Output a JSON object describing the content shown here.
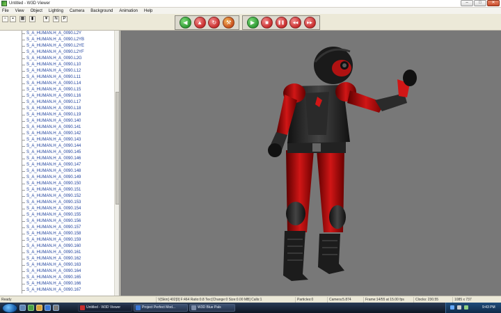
{
  "window": {
    "title": "Untitled - W3D Viewer",
    "buttons": [
      "–",
      "□",
      "✕"
    ]
  },
  "menu": [
    "File",
    "View",
    "Object",
    "Lighting",
    "Camera",
    "Background",
    "Animation",
    "Help"
  ],
  "toolbar": {
    "small_buttons": [
      "▫",
      "▪",
      "▦",
      "▮",
      "¥",
      "N",
      "P"
    ],
    "camera_buttons": [
      {
        "icon": "left-arrow-icon",
        "glyph": "◀",
        "color": "#2f9a34"
      },
      {
        "icon": "up-arrow-icon",
        "glyph": "▲",
        "color": "#c82d2d"
      },
      {
        "icon": "rotate-icon",
        "glyph": "↻",
        "color": "#c82d2d"
      },
      {
        "icon": "hammer-icon",
        "glyph": "⚒",
        "color": "#c82d2d"
      }
    ],
    "animation_buttons": [
      {
        "icon": "play-icon",
        "glyph": "▶",
        "color": "#2f9a34"
      },
      {
        "icon": "stop-icon",
        "glyph": "■",
        "color": "#c82d2d"
      },
      {
        "icon": "pause-icon",
        "glyph": "❚❚",
        "color": "#c82d2d"
      },
      {
        "icon": "rewind-icon",
        "glyph": "◀◀",
        "color": "#c82d2d"
      },
      {
        "icon": "fast-forward-icon",
        "glyph": "▶▶",
        "color": "#c82d2d"
      }
    ]
  },
  "tree": {
    "items": [
      "S_A_HUMAN.H_A_0090.L2Y",
      "S_A_HUMAN.H_A_0090.L2YB",
      "S_A_HUMAN.H_A_0090.L2YE",
      "S_A_HUMAN.H_A_0090.L2YF",
      "S_A_HUMAN.H_A_0090.L2G",
      "S_A_HUMAN.H_A_0090.L10",
      "S_A_HUMAN.H_A_0090.L12",
      "S_A_HUMAN.H_A_0090.L11",
      "S_A_HUMAN.H_A_0090.L14",
      "S_A_HUMAN.H_A_0090.L15",
      "S_A_HUMAN.H_A_0090.L16",
      "S_A_HUMAN.H_A_0090.L17",
      "S_A_HUMAN.H_A_0090.L18",
      "S_A_HUMAN.H_A_0090.L19",
      "S_A_HUMAN.H_A_0090.140",
      "S_A_HUMAN.H_A_0090.141",
      "S_A_HUMAN.H_A_0090.142",
      "S_A_HUMAN.H_A_0090.143",
      "S_A_HUMAN.H_A_0090.144",
      "S_A_HUMAN.H_A_0090.145",
      "S_A_HUMAN.H_A_0090.146",
      "S_A_HUMAN.H_A_0090.147",
      "S_A_HUMAN.H_A_0090.148",
      "S_A_HUMAN.H_A_0090.149",
      "S_A_HUMAN.H_A_0090.150",
      "S_A_HUMAN.H_A_0090.151",
      "S_A_HUMAN.H_A_0090.152",
      "S_A_HUMAN.H_A_0090.153",
      "S_A_HUMAN.H_A_0090.154",
      "S_A_HUMAN.H_A_0090.155",
      "S_A_HUMAN.H_A_0090.156",
      "S_A_HUMAN.H_A_0090.157",
      "S_A_HUMAN.H_A_0090.158",
      "S_A_HUMAN.H_A_0090.159",
      "S_A_HUMAN.H_A_0090.160",
      "S_A_HUMAN.H_A_0090.161",
      "S_A_HUMAN.H_A_0090.162",
      "S_A_HUMAN.H_A_0090.163",
      "S_A_HUMAN.H_A_0090.164",
      "S_A_HUMAN.H_A_0090.165",
      "S_A_HUMAN.H_A_0090.166",
      "S_A_HUMAN.H_A_0090.167"
    ]
  },
  "status": {
    "ready": "Ready",
    "skin": "V[Skin] 402[0] F:464 Ratio:0.8 Tex:[Change:0 Size:0.00 MB] Calls:1",
    "particles": "Particles:0",
    "camera": "Camera:5.874",
    "frame": "Frame:14/55 at 15.00 fps",
    "clocks": "Clocks: 230.55",
    "resolution": "1085 x 737"
  },
  "taskbar": {
    "items": [
      "Untitled - W3D Viewer",
      "Project Perfect Mod...",
      "W3D Blue Pals"
    ],
    "clock": "9:43 PM"
  },
  "colors": {
    "viewport_bg": "#787878",
    "tree_text": "#1c3f9c"
  }
}
